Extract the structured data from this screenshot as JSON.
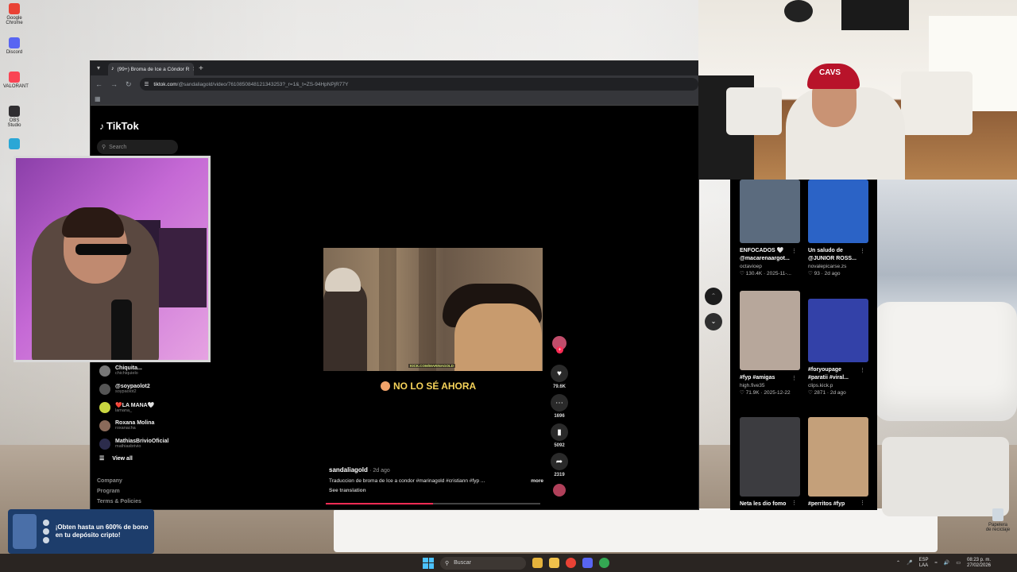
{
  "desktop": {
    "icons": [
      {
        "label": "Google Chrome",
        "color": "#e94235"
      },
      {
        "label": "Discord",
        "color": "#5865f2"
      },
      {
        "label": "VALORANT",
        "color": "#fa4454"
      },
      {
        "label": "OBS Studio",
        "color": "#302e31"
      },
      {
        "label": "",
        "color": "#2aa7d6"
      }
    ],
    "recycle_bin": "Papelera de reciclaje"
  },
  "browser": {
    "tab_title": "(99+) Broma de Ice a Cóndor R",
    "url_host": "tiktok.com",
    "url_path": "/@sandaliagold/video/7610850848121343253?_r=1&_t=ZS-94HpNPjR77Y"
  },
  "tiktok": {
    "logo": "TikTok",
    "search_placeholder": "Search",
    "following": [
      {
        "name": "Chiquita...",
        "user": "chichiquielo",
        "color": "#777"
      },
      {
        "name": "@soypaolot2",
        "user": "soypaolot2",
        "color": "#555"
      },
      {
        "name": "❤️LA MANA🤍",
        "user": "lamana_",
        "color": "#c9d640"
      },
      {
        "name": "Roxana Molina",
        "user": "roxanacha",
        "color": "#8a6a5a"
      },
      {
        "name": "MathiasBrivioOficial",
        "user": "mathiasbrivio",
        "color": "#2c2c4c"
      }
    ],
    "view_all": "View all",
    "footer": [
      "Company",
      "Program",
      "Terms & Policies"
    ],
    "video": {
      "caption_overlay": "NO LO SÉ AHORA",
      "watermark": "KICK.COM/MARINAGOLD",
      "author": "sandaliagold",
      "ago": "· 2d ago",
      "description": "Traduccion de broma de Ice a condor #marinagold #cristiann #fyp ...",
      "more": "more",
      "see_translation": "See translation",
      "progress": 0.5
    },
    "actions": {
      "likes": "79.6K",
      "comments": "1696",
      "saves": "5092",
      "shares": "2319"
    }
  },
  "recommendations": [
    {
      "title": "ENFOCADOS 🤍",
      "title2": "@macarenaargot...",
      "user": "octavioep",
      "stats": "♡ 130.4K · 2025-11-...",
      "color": "#5b6b7e"
    },
    {
      "title": "Un saludo de",
      "title2": "@JUNIOR ROSS...",
      "user": "novalepicarse.zs",
      "stats": "♡ 93 · 2d ago",
      "color": "#2b63c6"
    },
    {
      "title": "#fyp #amigas",
      "title2": "",
      "user": "high.five35",
      "stats": "♡ 71.9K · 2025-12-22",
      "color": "#b7a79b"
    },
    {
      "title": "#foryoupage",
      "title2": "#paratii #viral...",
      "user": "clips.kick.p",
      "stats": "♡ 2871 · 2d ago",
      "color": "#3341a8"
    },
    {
      "title": "Neta les dio fomo",
      "title2": "",
      "user": "",
      "stats": "",
      "color": "#3c3c40"
    },
    {
      "title": "#perritos #fyp",
      "title2": "",
      "user": "",
      "stats": "",
      "color": "#c4a07a"
    }
  ],
  "overlay_cam": {
    "cap_text": "CAVS"
  },
  "ad": {
    "text": "¡Obten hasta un 600% de bono en tu depósito cripto!"
  },
  "taskbar": {
    "search": "Buscar",
    "lang1": "ESP",
    "lang2": "LAA",
    "time": "08:23 p. m.",
    "date": "27/02/2026",
    "apps": [
      "#e5b33c",
      "#f0c14b",
      "#e94235",
      "#5865f2",
      "#34a853"
    ]
  }
}
